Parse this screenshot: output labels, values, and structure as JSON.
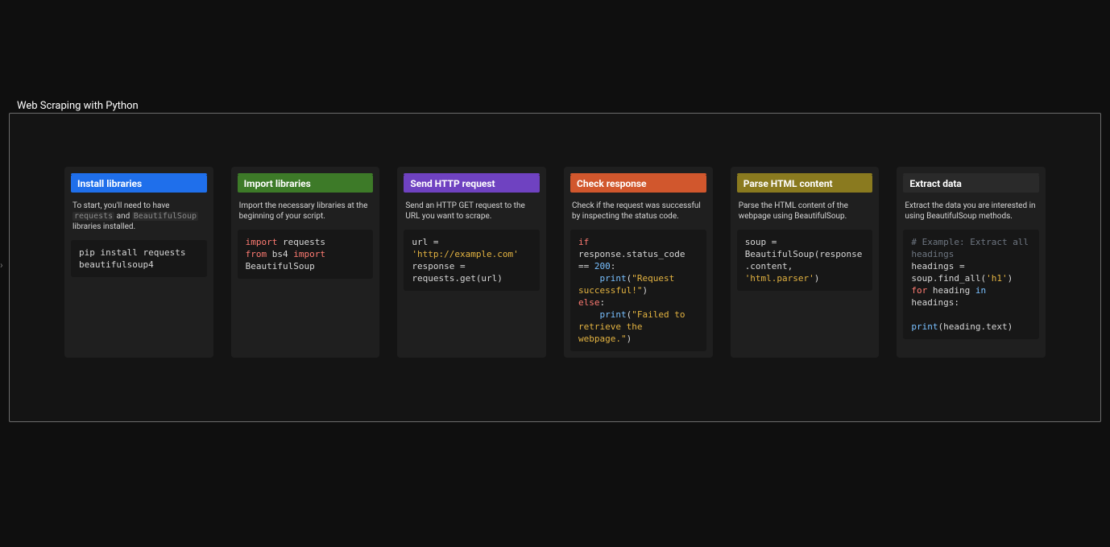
{
  "title": "Web Scraping with Python",
  "expand_arrow_glyph": "›",
  "cards": [
    {
      "header": "Install libraries",
      "header_class": "hdr-blue",
      "desc_html": "To start, you'll need to have <span class=\"code-inline\">requests</span> and <span class=\"code-inline\">BeautifulSoup</span> libraries installed.",
      "code_html": "pip install requests beautifulsoup4"
    },
    {
      "header": "Import libraries",
      "header_class": "hdr-green",
      "desc_html": "Import the necessary libraries at the beginning of your script.",
      "code_html": "<span class=\"tok-kw\">import</span> requests\n<span class=\"tok-kw\">from</span> bs4 <span class=\"tok-kw\">import</span> BeautifulSoup"
    },
    {
      "header": "Send HTTP request",
      "header_class": "hdr-purple",
      "desc_html": "Send an HTTP GET request to the URL you want to scrape.",
      "code_html": "url = <span class=\"tok-str\">'http://example.com'</span>\nresponse = requests.get(url)"
    },
    {
      "header": "Check response",
      "header_class": "hdr-orange",
      "desc_html": "Check if the request was successful by inspecting the status code.",
      "code_html": "<span class=\"tok-kw\">if</span> response.status_code == <span class=\"tok-num\">200</span>:\n    <span class=\"tok-fn\">print</span>(<span class=\"tok-str\">\"Request successful!\"</span>)\n<span class=\"tok-kw\">else</span>:\n    <span class=\"tok-fn\">print</span>(<span class=\"tok-str\">\"Failed to retrieve the webpage.\"</span>)"
    },
    {
      "header": "Parse HTML content",
      "header_class": "hdr-olive",
      "desc_html": "Parse the HTML content of the webpage using BeautifulSoup.",
      "code_html": "soup = BeautifulSoup(response.content, <span class=\"tok-str\">'html.parser'</span>)"
    },
    {
      "header": "Extract data",
      "header_class": "hdr-dark",
      "desc_html": "Extract the data you are interested in using BeautifulSoup methods.",
      "code_html": "<span class=\"tok-cmt\"># Example: Extract all headings</span>\nheadings = soup.find_all(<span class=\"tok-str\">'h1'</span>)\n<span class=\"tok-kw\">for</span> heading <span class=\"tok-in\">in</span> headings:\n\n<span class=\"tok-fn\">print</span>(heading.text)"
    }
  ]
}
